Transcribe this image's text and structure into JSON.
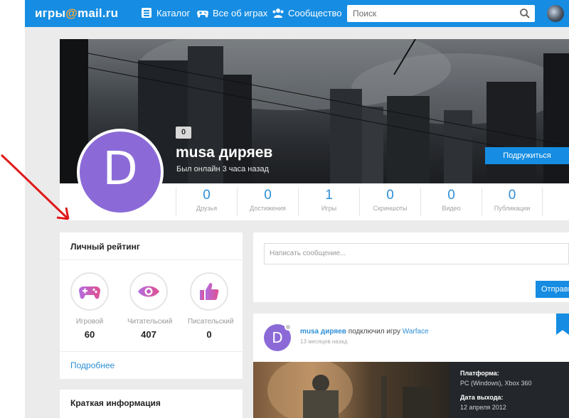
{
  "header": {
    "logo_part1": "игры",
    "logo_at": "@",
    "logo_part2": "mail.ru",
    "nav": [
      {
        "label": "Каталог",
        "icon": "catalog-icon"
      },
      {
        "label": "Все об играх",
        "icon": "gamepad-icon"
      },
      {
        "label": "Сообщество",
        "icon": "community-icon"
      }
    ],
    "search_placeholder": "Поиск"
  },
  "profile": {
    "badge": "0",
    "avatar_letter": "D",
    "name": "musa диряев",
    "status": "Был онлайн 3 часа назад",
    "friend_button": "Подружиться",
    "stats": [
      {
        "value": "0",
        "label": "Друзья"
      },
      {
        "value": "0",
        "label": "Достижения"
      },
      {
        "value": "1",
        "label": "Игры"
      },
      {
        "value": "0",
        "label": "Скриншоты"
      },
      {
        "value": "0",
        "label": "Видео"
      },
      {
        "value": "0",
        "label": "Публикации"
      }
    ]
  },
  "rating": {
    "title": "Личный рейтинг",
    "items": [
      {
        "label": "Игровой",
        "value": "60",
        "icon": "gamepad-icon"
      },
      {
        "label": "Читательский",
        "value": "407",
        "icon": "eye-icon"
      },
      {
        "label": "Писательский",
        "value": "0",
        "icon": "thumbs-up-icon"
      }
    ],
    "more_link": "Подробнее"
  },
  "info": {
    "title": "Краткая информация"
  },
  "message": {
    "placeholder": "Написать сообщение...",
    "send_button": "Отправить"
  },
  "feed": {
    "avatar_letter": "D",
    "user": "musa диряев",
    "action": "подключил игру",
    "game": "Warface",
    "time": "13 месяцев назад",
    "platform_label": "Платформа:",
    "platform_value": "PC (Windows), Xbox 360",
    "release_label": "Дата выхода:",
    "release_value": "12 апреля 2012"
  },
  "colors": {
    "brand": "#168de2",
    "accent": "#ffa930",
    "avatar": "#8b6ad8",
    "link": "#2d8fd6"
  }
}
